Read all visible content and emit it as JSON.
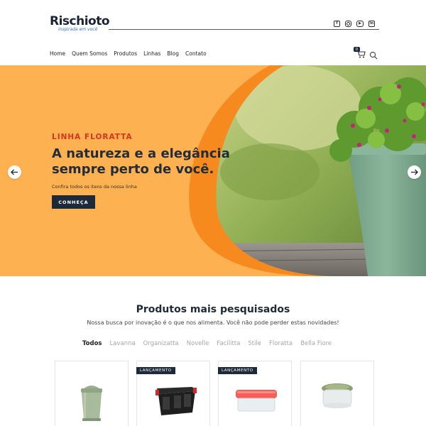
{
  "header": {
    "logo_text": "Rischioto",
    "logo_tagline": "inspirada em você",
    "social_icons": [
      "facebook-icon",
      "instagram-icon",
      "youtube-icon",
      "linkedin-icon"
    ],
    "nav": [
      "Home",
      "Quem Somos",
      "Produtos",
      "Linhas",
      "Blog",
      "Contato"
    ],
    "cart_count": "0"
  },
  "hero": {
    "eyebrow": "LINHA FLORATTA",
    "title": "A natureza e a elegância sempre perto de você.",
    "subtitle": "Confira todos os itens da nossa linha",
    "cta": "CONHEÇA",
    "accent_color": "#d7341d",
    "background_color": "#fdb150"
  },
  "products": {
    "title": "Produtos mais pesquisados",
    "subtitle": "Nossa busca por inovação é o que nos alimenta. Você não pode perder estas novidades!",
    "tabs": [
      "Todos",
      "Lavanna",
      "Organizatta",
      "Novelle",
      "Facilitta",
      "Stile",
      "Floratta",
      "Bella Fiore"
    ],
    "active_tab": "Todos",
    "cards": [
      {
        "badge": "",
        "item": "green-trash-bin"
      },
      {
        "badge": "LANÇAMENTO",
        "item": "black-storage-box"
      },
      {
        "badge": "LANÇAMENTO",
        "item": "red-lid-food-container"
      },
      {
        "badge": "",
        "item": "green-lid-round-container"
      }
    ]
  }
}
